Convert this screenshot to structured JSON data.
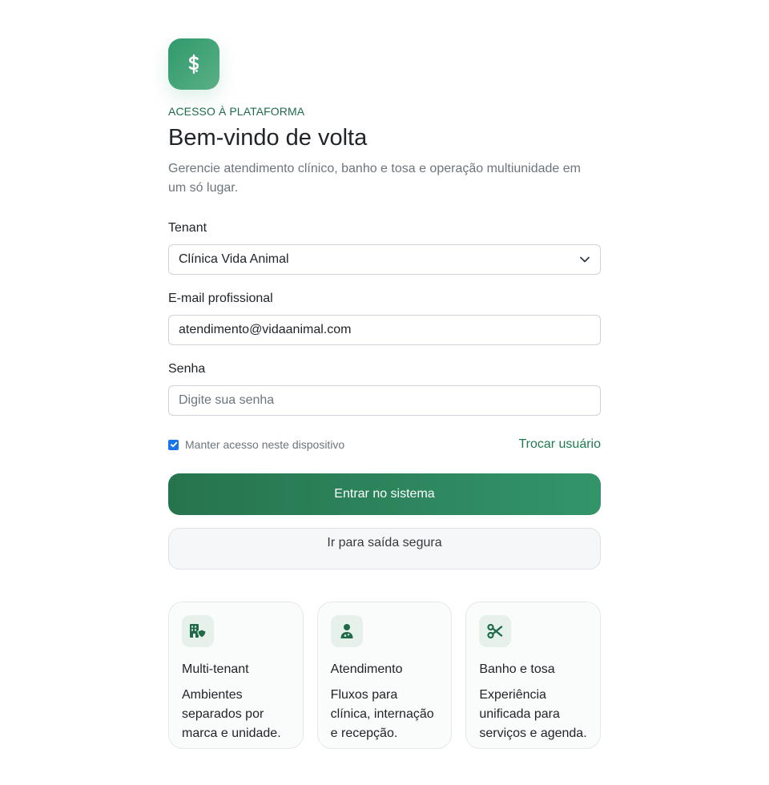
{
  "brand": {
    "icon": "medical-dollar-icon",
    "accent": "#2f9a6c"
  },
  "header": {
    "eyebrow": "ACESSO À PLATAFORMA",
    "title": "Bem-vindo de volta",
    "subtitle": "Gerencie atendimento clínico, banho e tosa e operação multiunidade em um só lugar."
  },
  "form": {
    "tenant_label": "Tenant",
    "tenant_value": "Clínica Vida Animal",
    "email_label": "E-mail profissional",
    "email_value": "atendimento@vidaanimal.com",
    "password_label": "Senha",
    "password_placeholder": "Digite sua senha",
    "remember_label": "Manter acesso neste dispositivo",
    "remember_checked": true,
    "switch_user": "Trocar usuário",
    "submit": "Entrar no sistema",
    "secure_exit": "Ir para saída segura"
  },
  "features": [
    {
      "icon": "building-shield-icon",
      "title": "Multi-tenant",
      "desc": "Ambientes separados por marca e unidade."
    },
    {
      "icon": "user-doctor-icon",
      "title": "Atendimento",
      "desc": "Fluxos para clínica, internação e recepção."
    },
    {
      "icon": "scissors-icon",
      "title": "Banho e tosa",
      "desc": "Experiência unificada para serviços e agenda."
    }
  ]
}
